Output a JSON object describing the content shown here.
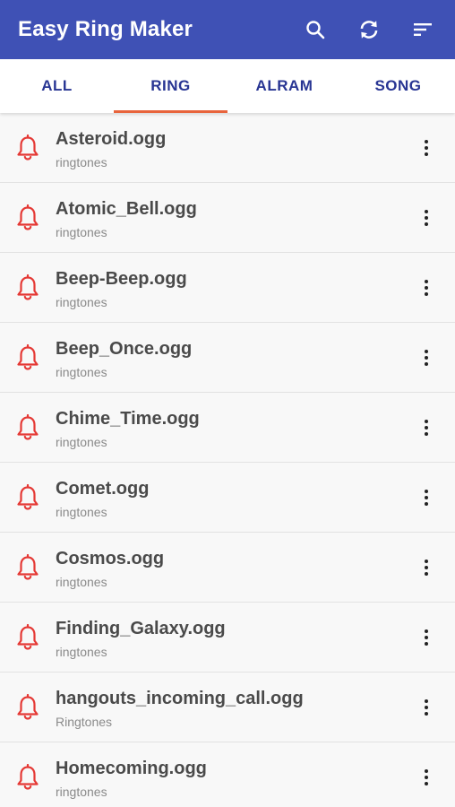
{
  "appbar": {
    "title": "Easy Ring Maker",
    "color": "#3f51b5",
    "actions": [
      {
        "icon": "search-icon"
      },
      {
        "icon": "refresh-icon"
      },
      {
        "icon": "sort-icon"
      }
    ]
  },
  "tabs": [
    {
      "label": "ALL",
      "active": false
    },
    {
      "label": "RING",
      "active": true
    },
    {
      "label": "ALRAM",
      "active": false
    },
    {
      "label": "SONG",
      "active": false
    }
  ],
  "accent_color": "#e8643c",
  "items": [
    {
      "name": "Asteroid.ogg",
      "folder": "ringtones"
    },
    {
      "name": "Atomic_Bell.ogg",
      "folder": "ringtones"
    },
    {
      "name": "Beep-Beep.ogg",
      "folder": "ringtones"
    },
    {
      "name": "Beep_Once.ogg",
      "folder": "ringtones"
    },
    {
      "name": "Chime_Time.ogg",
      "folder": "ringtones"
    },
    {
      "name": "Comet.ogg",
      "folder": "ringtones"
    },
    {
      "name": "Cosmos.ogg",
      "folder": "ringtones"
    },
    {
      "name": "Finding_Galaxy.ogg",
      "folder": "ringtones"
    },
    {
      "name": "hangouts_incoming_call.ogg",
      "folder": "Ringtones"
    },
    {
      "name": "Homecoming.ogg",
      "folder": "ringtones"
    }
  ]
}
